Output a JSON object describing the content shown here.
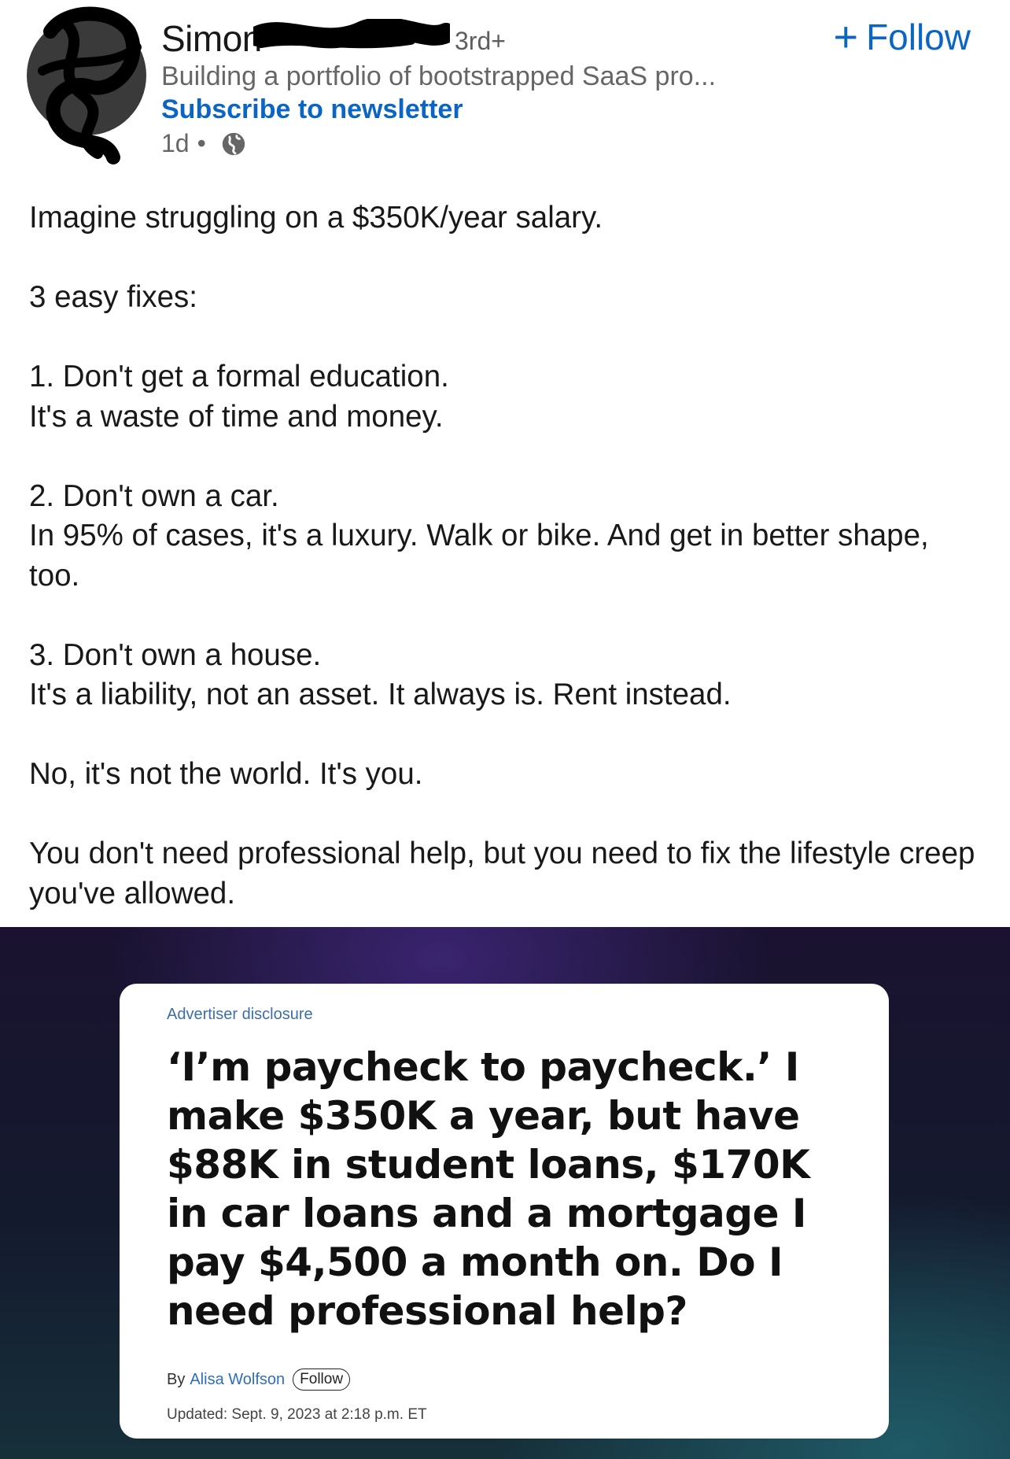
{
  "header": {
    "author_name": "Simon",
    "degree": "3rd+",
    "follow_label": "Follow",
    "follow_icon": "plus-icon",
    "headline": "Building a portfolio of bootstrapped SaaS pro...",
    "newsletter_label": "Subscribe to newsletter",
    "time_ago": "1d",
    "separator": "•",
    "visibility_icon": "globe-icon"
  },
  "body": {
    "paragraphs": [
      "Imagine struggling on a $350K/year salary.",
      "3 easy fixes:",
      "1. Don't get a formal education.\nIt's a waste of time and money.",
      "2. Don't own a car.\nIn 95% of cases, it's a luxury. Walk or bike. And get in better shape, too.",
      "3. Don't own a house.\nIt's a liability, not an asset. It always is. Rent instead.",
      "No, it's not the world. It's you.",
      "You don't need professional help, but you need to fix the lifestyle creep you've allowed."
    ]
  },
  "media": {
    "disclosure": "Advertiser disclosure",
    "article_title": "‘I’m paycheck to paycheck.’ I make $350K a year, but have $88K in student loans, $170K in car loans and a mortgage I pay $4,500 a month on. Do I need professional help?",
    "byline_prefix": "By",
    "byline_author": "Alisa Wolfson",
    "byline_follow": "Follow",
    "updated": "Updated: Sept. 9, 2023 at 2:18 p.m. ET"
  },
  "colors": {
    "link_blue": "#0a66c2",
    "muted_text": "#666666",
    "body_text": "#191919"
  }
}
